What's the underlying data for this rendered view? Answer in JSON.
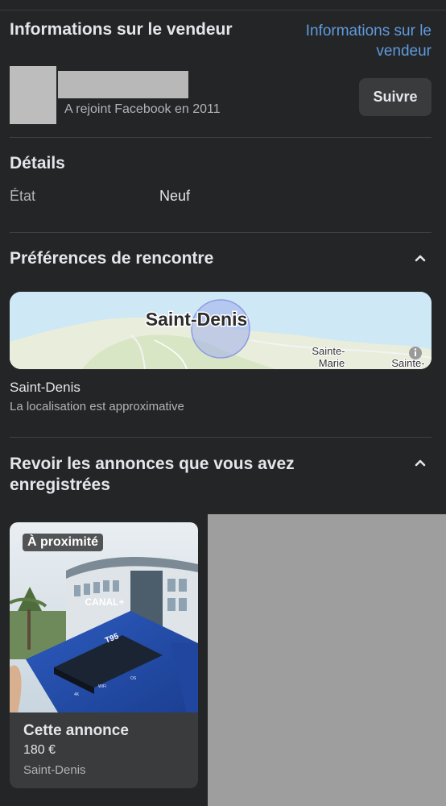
{
  "seller": {
    "title": "Informations sur le vendeur",
    "link_label": "Informations sur le vendeur",
    "joined": "A rejoint Facebook en 2011",
    "follow_label": "Suivre"
  },
  "details": {
    "title": "Détails",
    "condition_label": "État",
    "condition_value": "Neuf"
  },
  "meeting": {
    "title": "Préférences de rencontre",
    "chevron_icon": "chevron-up-icon",
    "map": {
      "city_label": "Saint-Denis",
      "place_1_line1": "Sainte-",
      "place_1_line2": "Marie",
      "place_2": "Sainte-",
      "info_icon": "info-icon"
    },
    "city": "Saint-Denis",
    "approx_note": "La localisation est approximative"
  },
  "saved": {
    "title": "Revoir les annonces que vous avez enregistrées",
    "chevron_icon": "chevron-up-icon",
    "listings": [
      {
        "badge": "À proximité",
        "title": "Cette annonce",
        "price": "180 €",
        "location": "Saint-Denis",
        "photo_sign": "CANAL+"
      }
    ]
  }
}
